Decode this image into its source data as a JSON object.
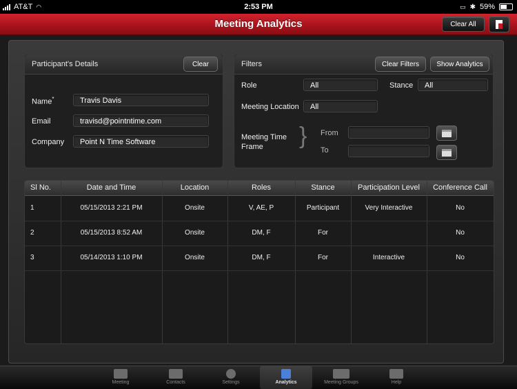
{
  "status": {
    "carrier": "AT&T",
    "time": "2:53 PM",
    "battery": "59%"
  },
  "header": {
    "title": "Meeting Analytics",
    "clear_all": "Clear All"
  },
  "participant": {
    "title": "Participant's Details",
    "clear": "Clear",
    "name_label": "Name",
    "name_required_mark": "*",
    "name_value": "Travis Davis",
    "email_label": "Email",
    "email_value": "travisd@pointntime.com",
    "company_label": "Company",
    "company_value": "Point N Time Software"
  },
  "filters": {
    "title": "Filters",
    "clear_filters": "Clear Filters",
    "show_analytics": "Show Analytics",
    "role_label": "Role",
    "role_value": "All",
    "stance_label": "Stance",
    "stance_value": "All",
    "location_label": "Meeting Location",
    "location_value": "All",
    "timeframe_label_1": "Meeting Time",
    "timeframe_label_2": "Frame",
    "from_label": "From",
    "from_value": "",
    "to_label": "To",
    "to_value": ""
  },
  "table": {
    "columns": [
      "Sl No.",
      "Date and Time",
      "Location",
      "Roles",
      "Stance",
      "Participation Level",
      "Conference Call"
    ],
    "rows": [
      [
        "1",
        "05/15/2013 2:21 PM",
        "Onsite",
        "V,  AE,  P",
        "Participant",
        "Very Interactive",
        "No"
      ],
      [
        "2",
        "05/15/2013 8:52 AM",
        "Onsite",
        "DM,  F",
        "For",
        "",
        "No"
      ],
      [
        "3",
        "05/14/2013 1:10 PM",
        "Onsite",
        "DM,  F",
        "For",
        "Interactive",
        "No"
      ]
    ]
  },
  "tabs": [
    {
      "label": "Meeting",
      "icon": "meeting-icon",
      "active": false
    },
    {
      "label": "Contacts",
      "icon": "contacts-icon",
      "active": false
    },
    {
      "label": "Settings",
      "icon": "gear-icon",
      "active": false
    },
    {
      "label": "Analytics",
      "icon": "analytics-icon",
      "active": true
    },
    {
      "label": "Meeting Groups",
      "icon": "groups-icon",
      "active": false
    },
    {
      "label": "Help",
      "icon": "help-icon",
      "active": false
    }
  ],
  "colors": {
    "accent": "#c81a24",
    "active_tab": "#4b7fd8"
  }
}
